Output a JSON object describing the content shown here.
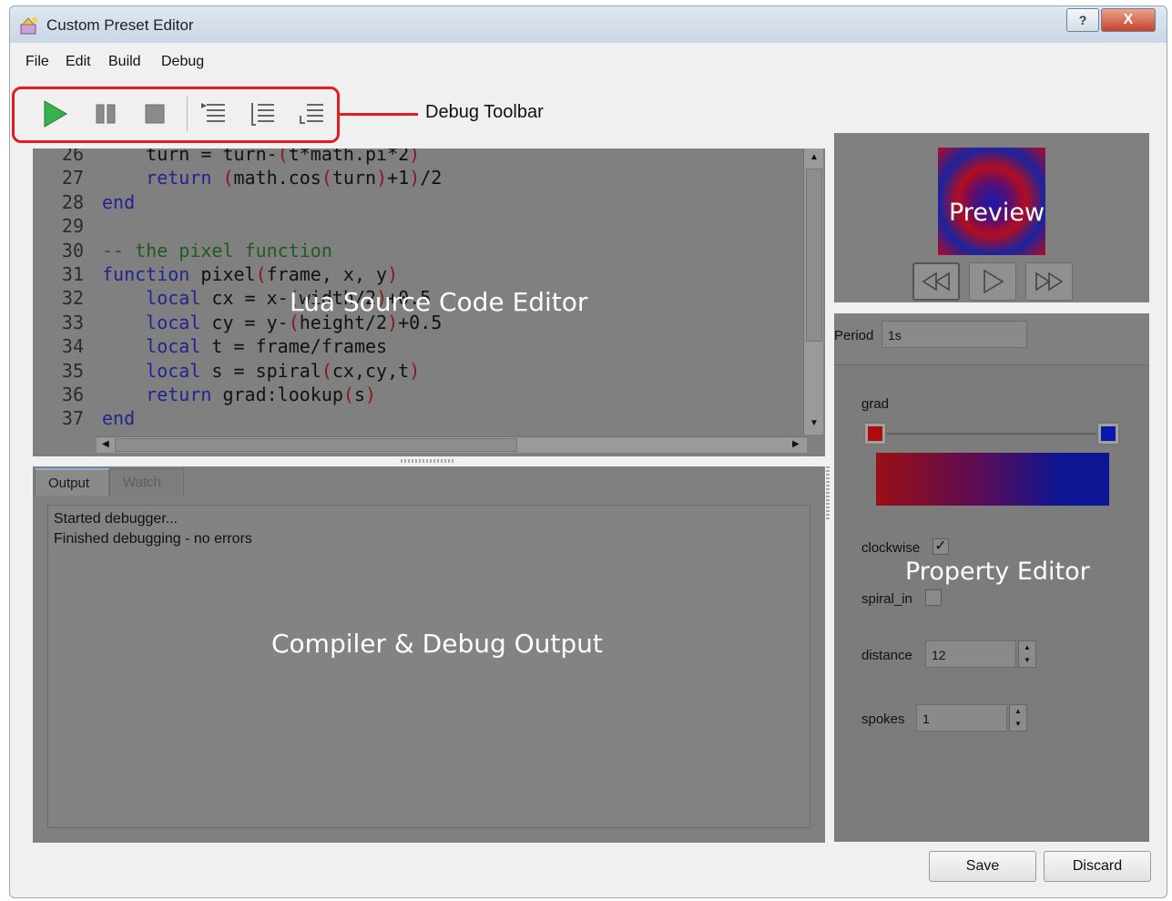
{
  "window": {
    "title": "Custom Preset Editor",
    "help_label": "?",
    "close_label": "X"
  },
  "menu": {
    "items": [
      "File",
      "Edit",
      "Build",
      "Debug"
    ]
  },
  "toolbar": {
    "annotation": "Debug Toolbar",
    "buttons": [
      "run-icon",
      "pause-icon",
      "stop-icon",
      "step-into-icon",
      "step-over-icon",
      "step-out-icon"
    ]
  },
  "editor": {
    "annotation": "Lua Source Code Editor",
    "lines": [
      {
        "n": "26",
        "code": "    turn = turn-(t*math.pi*2)"
      },
      {
        "n": "27",
        "code": "    return (math.cos(turn)+1)/2"
      },
      {
        "n": "28",
        "code": "end"
      },
      {
        "n": "29",
        "code": ""
      },
      {
        "n": "30",
        "code": "-- the pixel function"
      },
      {
        "n": "31",
        "code": "function pixel(frame, x, y)"
      },
      {
        "n": "32",
        "code": "    local cx = x-(width/2)+0.5"
      },
      {
        "n": "33",
        "code": "    local cy = y-(height/2)+0.5"
      },
      {
        "n": "34",
        "code": "    local t = frame/frames"
      },
      {
        "n": "35",
        "code": "    local s = spiral(cx,cy,t)"
      },
      {
        "n": "36",
        "code": "    return grad:lookup(s)"
      },
      {
        "n": "37",
        "code": "end"
      }
    ]
  },
  "output": {
    "annotation": "Compiler & Debug Output",
    "tabs": [
      "Output",
      "Watch"
    ],
    "lines": [
      "Started debugger...",
      "Finished debugging - no errors"
    ]
  },
  "preview": {
    "annotation": "Preview"
  },
  "properties": {
    "annotation": "Property Editor",
    "period_label": "Period",
    "period_value": "1s",
    "grad_label": "grad",
    "grad_start_color": "#b00c10",
    "grad_end_color": "#0b18a8",
    "clockwise_label": "clockwise",
    "clockwise_checked": true,
    "spiral_in_label": "spiral_in",
    "spiral_in_checked": false,
    "distance_label": "distance",
    "distance_value": "12",
    "spokes_label": "spokes",
    "spokes_value": "1"
  },
  "footer": {
    "save_label": "Save",
    "discard_label": "Discard"
  },
  "colors": {
    "callout_red": "#e31b23",
    "panel_gray": "#808080"
  }
}
